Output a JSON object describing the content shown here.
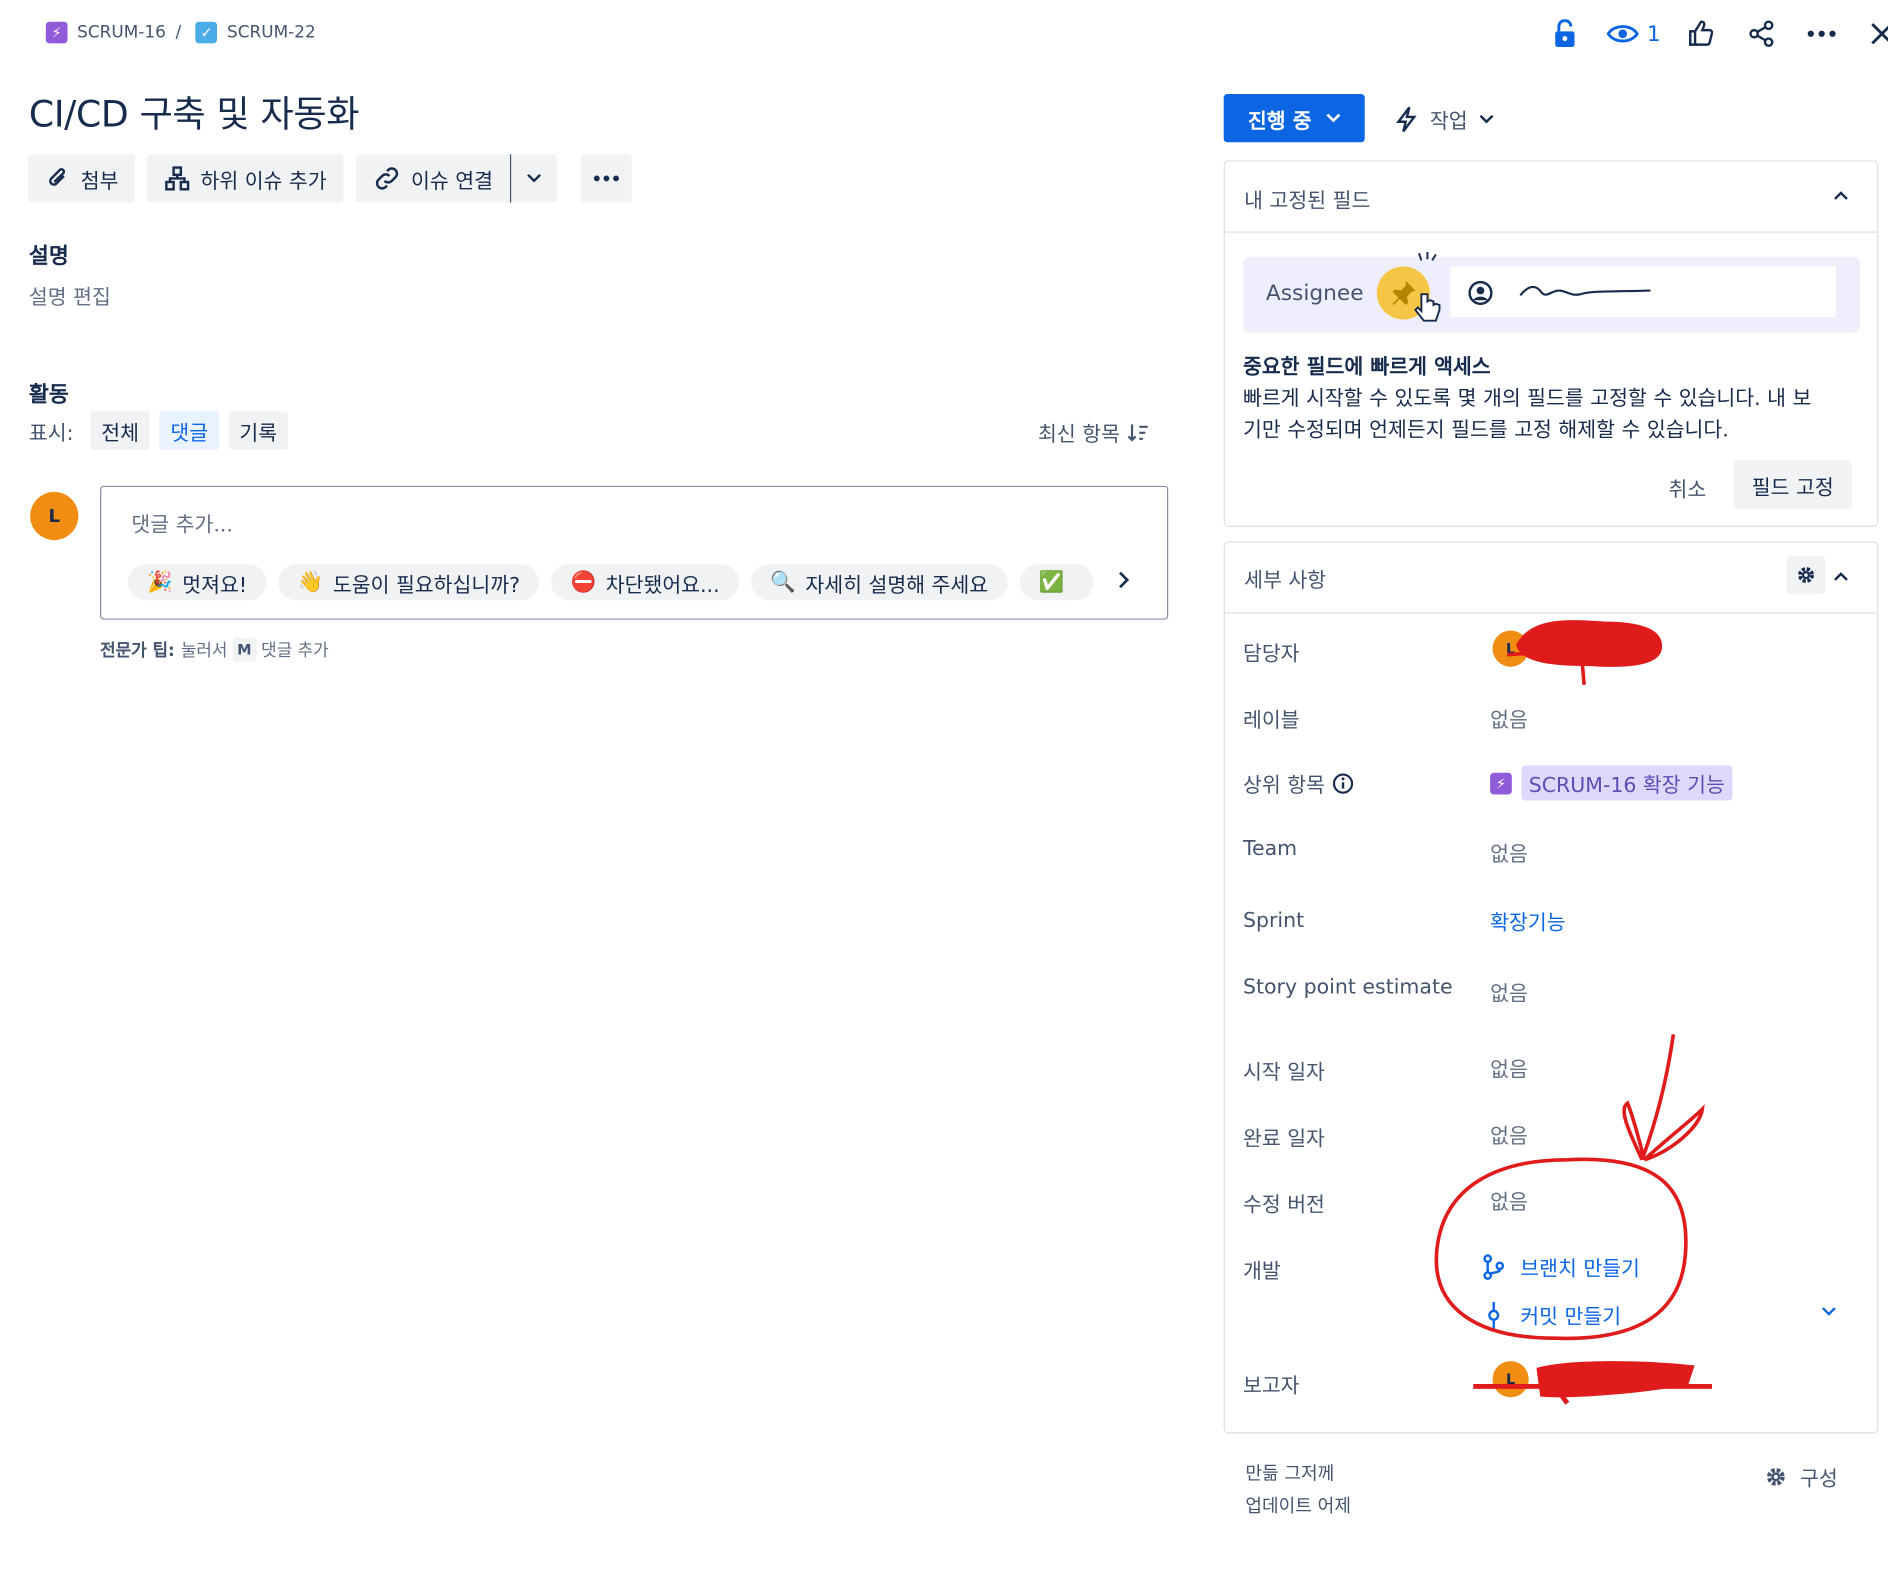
{
  "breadcrumb": {
    "parent_key": "SCRUM-16",
    "current_key": "SCRUM-22",
    "separator": "/"
  },
  "header_actions": {
    "watch_count": "1"
  },
  "issue": {
    "title": "CI/CD 구축 및 자동화"
  },
  "toolbar": {
    "attach_label": "첨부",
    "add_subtask_label": "하위 이슈 추가",
    "link_issue_label": "이슈 연결"
  },
  "description": {
    "heading": "설명",
    "placeholder": "설명 편집"
  },
  "activity": {
    "heading": "활동",
    "show_label": "표시:",
    "filters": [
      "전체",
      "댓글",
      "기록"
    ],
    "selected_filter": "댓글",
    "sort_label": "최신 항목",
    "avatar_initial": "L",
    "comment_placeholder": "댓글 추가...",
    "quick_replies": [
      {
        "emoji": "🎉",
        "label": "멋져요!"
      },
      {
        "emoji": "👋",
        "label": "도움이 필요하십니까?"
      },
      {
        "emoji": "⛔",
        "label": "차단됐어요..."
      },
      {
        "emoji": "🔍",
        "label": "자세히 설명해 주세요"
      },
      {
        "emoji": "✅",
        "label": ""
      }
    ],
    "tip_prefix": "전문가 팁:",
    "tip_press": "눌러서",
    "tip_key": "M",
    "tip_suffix": "댓글 추가"
  },
  "status": {
    "label": "진행 중",
    "action_label": "작업"
  },
  "pinned": {
    "heading": "내 고정된 필드",
    "assignee_label": "Assignee",
    "promo_title": "중요한 필드에 빠르게 액세스",
    "promo_body_line1": "빠르게 시작할 수 있도록 몇 개의 필드를 고정할 수 있습니다. 내 보",
    "promo_body_line2": "기만 수정되며 언제든지 필드를 고정 해제할 수 있습니다.",
    "cancel_label": "취소",
    "pin_label": "필드 고정"
  },
  "details": {
    "heading": "세부 사항",
    "assignee_label": "담당자",
    "assignee_initial": "L",
    "labels_label": "레이블",
    "labels_value": "없음",
    "parent_label": "상위 항목",
    "parent_value": "SCRUM-16 확장 기능",
    "team_label": "Team",
    "team_value": "없음",
    "sprint_label": "Sprint",
    "sprint_value": "확장기능",
    "story_points_label": "Story point estimate",
    "story_points_value": "없음",
    "start_date_label": "시작 일자",
    "start_date_value": "없음",
    "due_date_label": "완료 일자",
    "due_date_value": "없음",
    "fix_version_label": "수정 버전",
    "fix_version_value": "없음",
    "development_label": "개발",
    "create_branch": "브랜치 만들기",
    "create_commit": "커밋 만들기",
    "reporter_label": "보고자",
    "reporter_initial": "L"
  },
  "footer": {
    "created": "만듦 그저께",
    "updated": "업데이트 어제",
    "configure_label": "구성"
  },
  "colors": {
    "primary": "#0c66e4",
    "epic": "#8f5bd9",
    "task": "#4bade8",
    "avatar": "#f18d13",
    "annotation_red": "#e01b1b"
  }
}
